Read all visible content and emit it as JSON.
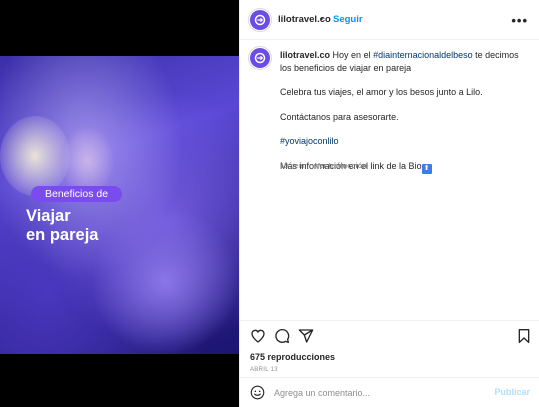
{
  "media": {
    "badge": "Beneficios de",
    "headline_line1": "Viajar",
    "headline_line2": "en pareja",
    "logo_icon": "lilo-logo-icon"
  },
  "header": {
    "username": "lilotravel.co",
    "dot": "•",
    "follow_label": "Seguir",
    "more_icon": "more-options-icon"
  },
  "caption": {
    "username": "lilotravel.co",
    "intro_before": "Hoy en el ",
    "hashtag1": "#diainternacionaldelbeso",
    "intro_after": " te decimos los beneficios de viajar en pareja",
    "line2": "Celebra tus viajes, el amor y los besos junto a Lilo.",
    "line3": "Contáctanos para asesorarte.",
    "hashtag2": "#yoviajoconlilo",
    "line5": "Más información en el link de la Bio",
    "line5_emoji": "⬆"
  },
  "meta": {
    "age": "19 sem",
    "translate": "Ver traducción"
  },
  "actions": {
    "like_icon": "heart-icon",
    "comment_icon": "comment-icon",
    "share_icon": "share-icon",
    "save_icon": "bookmark-icon"
  },
  "stats": {
    "views": "675 reproducciones",
    "date": "ABRIL 13"
  },
  "comment": {
    "emoji_icon": "emoji-icon",
    "placeholder": "Agrega un comentario...",
    "publish_label": "Publicar"
  },
  "colors": {
    "brand_purple": "#6b4ce6",
    "follow_blue": "#0095f6",
    "hashtag_blue": "#00376b",
    "publish_disabled": "#b2dffc"
  }
}
